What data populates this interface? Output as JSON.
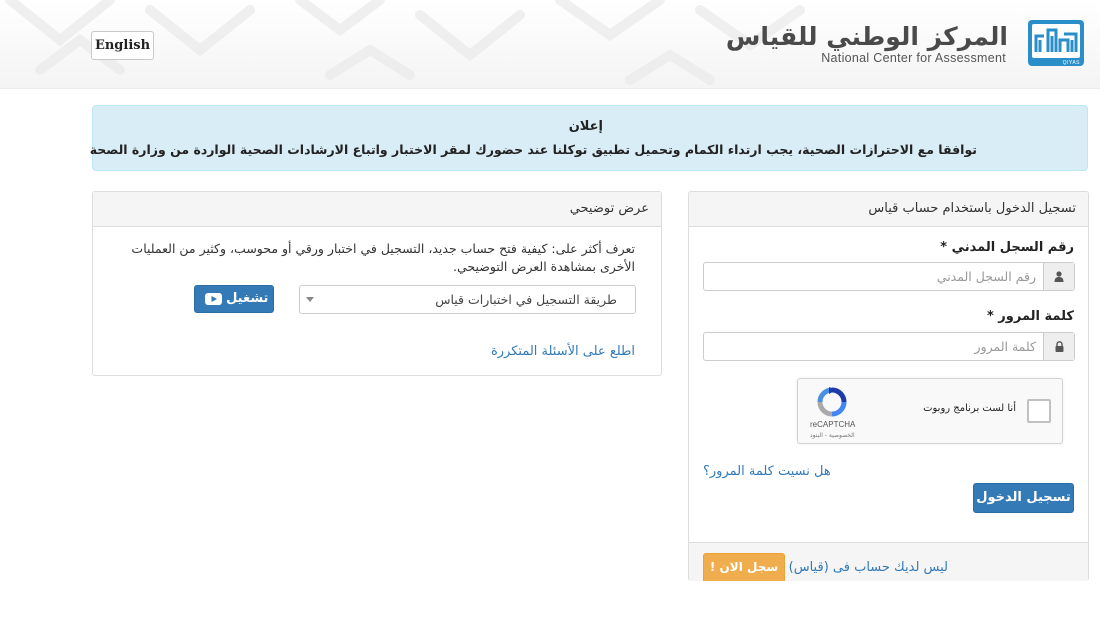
{
  "header": {
    "language_button": "English",
    "logo_arabic": "المركز الوطني للقياس",
    "logo_english": "National Center for Assessment",
    "logo_mark_text": "QIYAS",
    "brand_color": "#2a8fc8"
  },
  "notice": {
    "title": "إعلان",
    "body": "توافقا مع الاحترازات الصحية، يجب ارتداء الكمام وتحميل تطبيق توكلنا عند حضورك لمقر الاختبار واتباع الارشادات الصحية الواردة من وزارة الصحة"
  },
  "login": {
    "title": "تسجيل الدخول باستخدام حساب قياس",
    "id_label": "رقم السجل المدني",
    "id_placeholder": "رقم السجل المدني",
    "password_label": "كلمة المرور",
    "password_placeholder": "كلمة المرور",
    "required_mark": "*",
    "captcha_label": "أنا لست برنامج روبوت",
    "captcha_brand": "reCAPTCHA",
    "captcha_terms": "الخصوصية - البنود",
    "forgot_password": "هل نسيت كلمة المرور؟",
    "submit_button": "تسجيل الدخول",
    "no_account_text": "ليس لديك حساب فى (قياس)",
    "register_button": "سجل الان !"
  },
  "demo": {
    "title": "عرض توضيحي",
    "description": "تعرف أكثر على: كيفية فتح حساب جديد، التسجيل في اختبار ورقي أو محوسب، وكثير من العمليات الأخرى بمشاهدة العرض التوضيحي.",
    "select_value": "طريقة التسجيل في اختبارات قياس",
    "play_button": "تشغيل",
    "faq_link": "اطلع على الأسئلة المتكررة"
  },
  "colors": {
    "primary": "#337ab7",
    "warning": "#f0ad4e",
    "info_bg": "#d9edf7",
    "link": "#337ab7"
  }
}
